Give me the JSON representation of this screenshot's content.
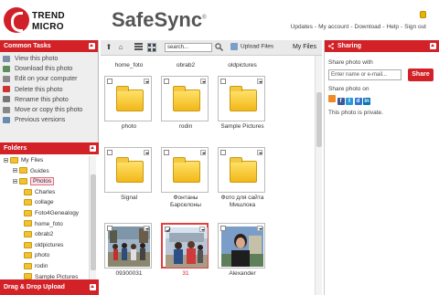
{
  "header": {
    "logo_line1": "TREND",
    "logo_line2": "MICRO",
    "brand": "SafeSync",
    "brand_mark": "®",
    "links": [
      "Updates",
      "My account",
      "Download",
      "Help",
      "Sign out"
    ],
    "link_separator": "-"
  },
  "left": {
    "common_tasks_title": "Common Tasks",
    "tasks": [
      {
        "label": "View this photo",
        "icon": "view-icon"
      },
      {
        "label": "Download this photo",
        "icon": "download-icon"
      },
      {
        "label": "Edit on your computer",
        "icon": "edit-icon"
      },
      {
        "label": "Delete this photo",
        "icon": "delete-icon"
      },
      {
        "label": "Rename this photo",
        "icon": "rename-icon"
      },
      {
        "label": "Move or copy this photo",
        "icon": "move-icon"
      },
      {
        "label": "Previous versions",
        "icon": "history-icon"
      }
    ],
    "folders_title": "Folders",
    "tree": [
      {
        "label": "My Files",
        "level": 0,
        "toggle": true
      },
      {
        "label": "Guides",
        "level": 1,
        "toggle": true
      },
      {
        "label": "Photos",
        "level": 1,
        "toggle": true,
        "selected": true
      },
      {
        "label": "Charles",
        "level": 2,
        "toggle": false
      },
      {
        "label": "collage",
        "level": 2,
        "toggle": false
      },
      {
        "label": "Foto4Genealogy",
        "level": 2,
        "toggle": false
      },
      {
        "label": "home_foto",
        "level": 2,
        "toggle": false
      },
      {
        "label": "obrab2",
        "level": 2,
        "toggle": false
      },
      {
        "label": "oldpictures",
        "level": 2,
        "toggle": false
      },
      {
        "label": "photo",
        "level": 2,
        "toggle": false
      },
      {
        "label": "rodin",
        "level": 2,
        "toggle": false
      },
      {
        "label": "Sample Pictures",
        "level": 2,
        "toggle": false
      }
    ],
    "dnd_title": "Drag & Drop Upload"
  },
  "toolbar": {
    "up_symbol": "⬆",
    "home_symbol": "⌂",
    "search_placeholder": "search...",
    "upload_label": "Upload Files",
    "location_label": "My Files"
  },
  "grid": {
    "top_labels": [
      "home_foto",
      "obrab2",
      "oldpictures"
    ],
    "items": [
      {
        "label": "photo",
        "kind": "folder"
      },
      {
        "label": "rodin",
        "kind": "folder"
      },
      {
        "label": "Sample Pictures",
        "kind": "folder"
      },
      {
        "label": "Signal",
        "kind": "folder"
      },
      {
        "label": "Фонтаны Барселоны",
        "kind": "folder"
      },
      {
        "label": "Фото для сайта Мишлока",
        "kind": "folder"
      },
      {
        "label": "09300031",
        "kind": "photo",
        "selected": false
      },
      {
        "label": "31",
        "kind": "photo",
        "selected": true
      },
      {
        "label": "Alexander",
        "kind": "photo",
        "selected": false
      }
    ]
  },
  "right": {
    "title": "Sharing",
    "share_with_label": "Share photo with",
    "share_input_placeholder": "Enter name or e-mail...",
    "share_button": "Share",
    "share_on_label": "Share photo on",
    "social": [
      {
        "name": "rss-icon",
        "letter": "",
        "color": "#f08a24"
      },
      {
        "name": "facebook-icon",
        "letter": "f",
        "color": "#3b5998"
      },
      {
        "name": "twitter-icon",
        "letter": "t",
        "color": "#2a9ad6"
      },
      {
        "name": "delicious-icon",
        "letter": "d",
        "color": "#3274d1"
      },
      {
        "name": "linkedin-icon",
        "letter": "in",
        "color": "#0b76b4"
      }
    ],
    "private_note": "This photo is private."
  },
  "colors": {
    "accent": "#d32227",
    "folder": "#f2b719",
    "selection": "#e04040"
  }
}
